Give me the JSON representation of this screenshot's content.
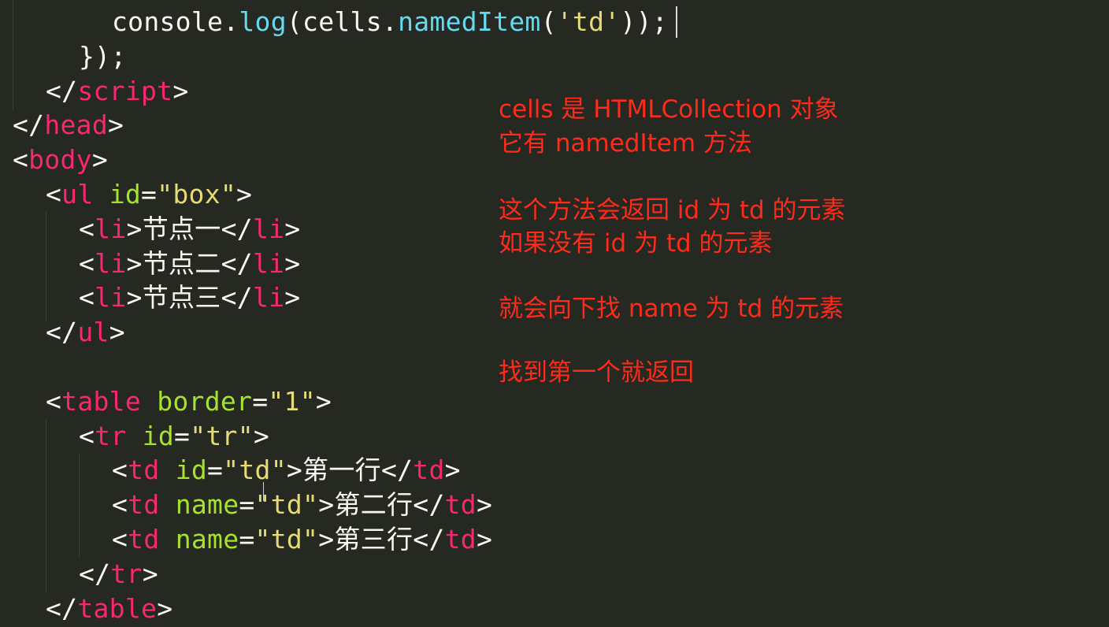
{
  "editor": {
    "theme_colors": {
      "background": "#262822",
      "tag": "#f92672",
      "attribute": "#a6e22e",
      "string": "#e6db74",
      "method": "#66d9ef",
      "text": "#f8f8f2",
      "annotation": "#ff2a1a"
    },
    "lines": [
      {
        "indent": 3,
        "tokens": [
          {
            "t": "console",
            "c": "text"
          },
          {
            "t": ".",
            "c": "punct"
          },
          {
            "t": "log",
            "c": "method"
          },
          {
            "t": "(cells",
            "c": "text"
          },
          {
            "t": ".",
            "c": "punct"
          },
          {
            "t": "namedItem",
            "c": "method"
          },
          {
            "t": "(",
            "c": "punct"
          },
          {
            "t": "'td'",
            "c": "str"
          },
          {
            "t": "));",
            "c": "punct"
          }
        ]
      },
      {
        "indent": 2,
        "tokens": [
          {
            "t": "});",
            "c": "punct"
          }
        ]
      },
      {
        "indent": 1,
        "tokens": [
          {
            "t": "</",
            "c": "punct"
          },
          {
            "t": "script",
            "c": "tag"
          },
          {
            "t": ">",
            "c": "punct"
          }
        ]
      },
      {
        "indent": 0,
        "tokens": [
          {
            "t": "</",
            "c": "punct"
          },
          {
            "t": "head",
            "c": "tag"
          },
          {
            "t": ">",
            "c": "punct"
          }
        ]
      },
      {
        "indent": 0,
        "tokens": [
          {
            "t": "<",
            "c": "punct"
          },
          {
            "t": "body",
            "c": "tag"
          },
          {
            "t": ">",
            "c": "punct"
          }
        ]
      },
      {
        "indent": 1,
        "tokens": [
          {
            "t": "<",
            "c": "punct"
          },
          {
            "t": "ul",
            "c": "tag"
          },
          {
            "t": " ",
            "c": "punct"
          },
          {
            "t": "id",
            "c": "attr"
          },
          {
            "t": "=",
            "c": "punct"
          },
          {
            "t": "\"box\"",
            "c": "str"
          },
          {
            "t": ">",
            "c": "punct"
          }
        ]
      },
      {
        "indent": 2,
        "tokens": [
          {
            "t": "<",
            "c": "punct"
          },
          {
            "t": "li",
            "c": "tag"
          },
          {
            "t": ">",
            "c": "punct"
          },
          {
            "t": "节点一",
            "c": "text"
          },
          {
            "t": "</",
            "c": "punct"
          },
          {
            "t": "li",
            "c": "tag"
          },
          {
            "t": ">",
            "c": "punct"
          }
        ]
      },
      {
        "indent": 2,
        "tokens": [
          {
            "t": "<",
            "c": "punct"
          },
          {
            "t": "li",
            "c": "tag"
          },
          {
            "t": ">",
            "c": "punct"
          },
          {
            "t": "节点二",
            "c": "text"
          },
          {
            "t": "</",
            "c": "punct"
          },
          {
            "t": "li",
            "c": "tag"
          },
          {
            "t": ">",
            "c": "punct"
          }
        ]
      },
      {
        "indent": 2,
        "tokens": [
          {
            "t": "<",
            "c": "punct"
          },
          {
            "t": "li",
            "c": "tag"
          },
          {
            "t": ">",
            "c": "punct"
          },
          {
            "t": "节点三",
            "c": "text"
          },
          {
            "t": "</",
            "c": "punct"
          },
          {
            "t": "li",
            "c": "tag"
          },
          {
            "t": ">",
            "c": "punct"
          }
        ]
      },
      {
        "indent": 1,
        "tokens": [
          {
            "t": "</",
            "c": "punct"
          },
          {
            "t": "ul",
            "c": "tag"
          },
          {
            "t": ">",
            "c": "punct"
          }
        ]
      },
      {
        "indent": 0,
        "tokens": []
      },
      {
        "indent": 1,
        "tokens": [
          {
            "t": "<",
            "c": "punct"
          },
          {
            "t": "table",
            "c": "tag"
          },
          {
            "t": " ",
            "c": "punct"
          },
          {
            "t": "border",
            "c": "attr"
          },
          {
            "t": "=",
            "c": "punct"
          },
          {
            "t": "\"1\"",
            "c": "str"
          },
          {
            "t": ">",
            "c": "punct"
          }
        ]
      },
      {
        "indent": 2,
        "tokens": [
          {
            "t": "<",
            "c": "punct"
          },
          {
            "t": "tr",
            "c": "tag"
          },
          {
            "t": " ",
            "c": "punct"
          },
          {
            "t": "id",
            "c": "attr"
          },
          {
            "t": "=",
            "c": "punct"
          },
          {
            "t": "\"tr\"",
            "c": "str"
          },
          {
            "t": ">",
            "c": "punct"
          }
        ]
      },
      {
        "indent": 3,
        "tokens": [
          {
            "t": "<",
            "c": "punct"
          },
          {
            "t": "td",
            "c": "tag"
          },
          {
            "t": " ",
            "c": "punct"
          },
          {
            "t": "id",
            "c": "attr"
          },
          {
            "t": "=",
            "c": "punct"
          },
          {
            "t": "\"td\"",
            "c": "str"
          },
          {
            "t": ">",
            "c": "punct"
          },
          {
            "t": "第一行",
            "c": "text"
          },
          {
            "t": "</",
            "c": "punct"
          },
          {
            "t": "td",
            "c": "tag"
          },
          {
            "t": ">",
            "c": "punct"
          }
        ]
      },
      {
        "indent": 3,
        "tokens": [
          {
            "t": "<",
            "c": "punct"
          },
          {
            "t": "td",
            "c": "tag"
          },
          {
            "t": " ",
            "c": "punct"
          },
          {
            "t": "name",
            "c": "attr"
          },
          {
            "t": "=",
            "c": "punct"
          },
          {
            "t": "\"td\"",
            "c": "str"
          },
          {
            "t": ">",
            "c": "punct"
          },
          {
            "t": "第二行",
            "c": "text"
          },
          {
            "t": "</",
            "c": "punct"
          },
          {
            "t": "td",
            "c": "tag"
          },
          {
            "t": ">",
            "c": "punct"
          }
        ]
      },
      {
        "indent": 3,
        "tokens": [
          {
            "t": "<",
            "c": "punct"
          },
          {
            "t": "td",
            "c": "tag"
          },
          {
            "t": " ",
            "c": "punct"
          },
          {
            "t": "name",
            "c": "attr"
          },
          {
            "t": "=",
            "c": "punct"
          },
          {
            "t": "\"td\"",
            "c": "str"
          },
          {
            "t": ">",
            "c": "punct"
          },
          {
            "t": "第三行",
            "c": "text"
          },
          {
            "t": "</",
            "c": "punct"
          },
          {
            "t": "td",
            "c": "tag"
          },
          {
            "t": ">",
            "c": "punct"
          }
        ]
      },
      {
        "indent": 2,
        "tokens": [
          {
            "t": "</",
            "c": "punct"
          },
          {
            "t": "tr",
            "c": "tag"
          },
          {
            "t": ">",
            "c": "punct"
          }
        ]
      },
      {
        "indent": 1,
        "tokens": [
          {
            "t": "</",
            "c": "punct"
          },
          {
            "t": "table",
            "c": "tag"
          },
          {
            "t": ">",
            "c": "punct"
          }
        ]
      }
    ]
  },
  "annotation": {
    "line1": "cells 是 HTMLCollection 对象",
    "line2": "它有 namedItem 方法",
    "line3": "这个方法会返回 id 为 td 的元素",
    "line4": "如果没有 id 为 td 的元素",
    "line5": "就会向下找 name 为 td 的元素",
    "line6": "找到第一个就返回"
  }
}
